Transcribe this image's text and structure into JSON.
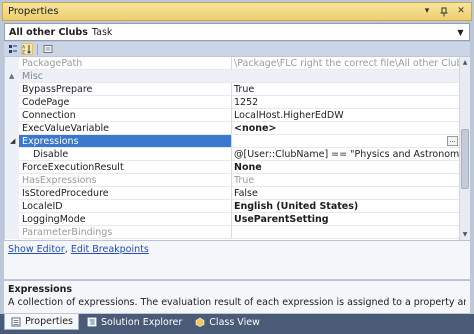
{
  "window": {
    "title": "Properties",
    "pin_icon": "pin-icon",
    "close_icon": "close-icon"
  },
  "selector": {
    "object_name": "All other Clubs",
    "object_type": "Task"
  },
  "toolbar": {
    "categorized": "categorized-icon",
    "alphabetical": "alphabetical-icon",
    "property_pages": "property-pages-icon"
  },
  "grid": {
    "rows": [
      {
        "name": "PackagePath",
        "value": "\\Package\\FLC right the correct file\\All other Clubs",
        "dim": true
      },
      {
        "category": "Misc"
      },
      {
        "name": "BypassPrepare",
        "value": "True"
      },
      {
        "name": "CodePage",
        "value": "1252"
      },
      {
        "name": "Connection",
        "value": "LocalHost.HigherEdDW"
      },
      {
        "name": "ExecValueVariable",
        "value": "<none>",
        "bold": true
      },
      {
        "name": "Expressions",
        "value": "",
        "selected": true,
        "expandable": true
      },
      {
        "name": "Disable",
        "value": "@[User::ClubName] == \"Physics and Astronomy Club\"",
        "sub": true
      },
      {
        "name": "ForceExecutionResult",
        "value": "None",
        "bold": true
      },
      {
        "name": "HasExpressions",
        "value": "True",
        "dim": true
      },
      {
        "name": "IsStoredProcedure",
        "value": "False"
      },
      {
        "name": "LocaleID",
        "value": "English (United States)",
        "bold": true
      },
      {
        "name": "LoggingMode",
        "value": "UseParentSetting",
        "bold": true
      },
      {
        "name": "ParameterBindings",
        "value": "",
        "dim": true
      }
    ]
  },
  "commands": {
    "show_editor": "Show Editor",
    "separator": ",",
    "edit_breakpoints": "Edit Breakpoints"
  },
  "description": {
    "title": "Expressions",
    "text": "A collection of expressions. The evaluation result of each expression is assigned to a property and replaces the value o..."
  },
  "tabs": [
    {
      "label": "Properties",
      "active": true
    },
    {
      "label": "Solution Explorer",
      "active": false
    },
    {
      "label": "Class View",
      "active": false
    }
  ],
  "colors": {
    "title_bar": "#eccf6d",
    "selection": "#3a78d0",
    "link": "#1f4fb6",
    "tab_strip": "#4a5b78"
  }
}
